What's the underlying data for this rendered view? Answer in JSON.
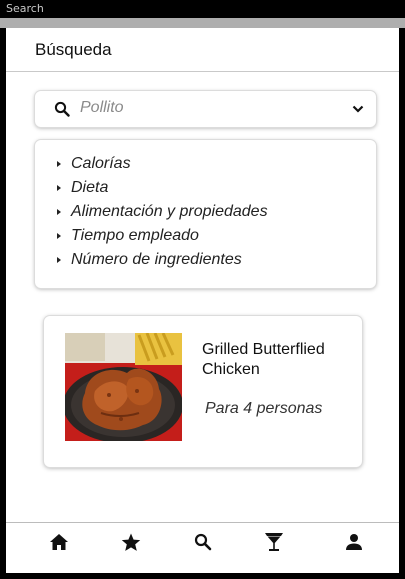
{
  "os_bar": {
    "label": "Search"
  },
  "header": {
    "title": "Búsqueda"
  },
  "search": {
    "value": "Pollito"
  },
  "filters": [
    "Calorías",
    "Dieta",
    "Alimentación y propiedades",
    "Tiempo empleado",
    "Número de ingredientes"
  ],
  "recipe": {
    "title": "Grilled Butterflied Chicken",
    "serves": "Para 4 personas"
  },
  "nav": [
    "home-icon",
    "star-icon",
    "search-icon",
    "cocktail-icon",
    "person-icon"
  ]
}
